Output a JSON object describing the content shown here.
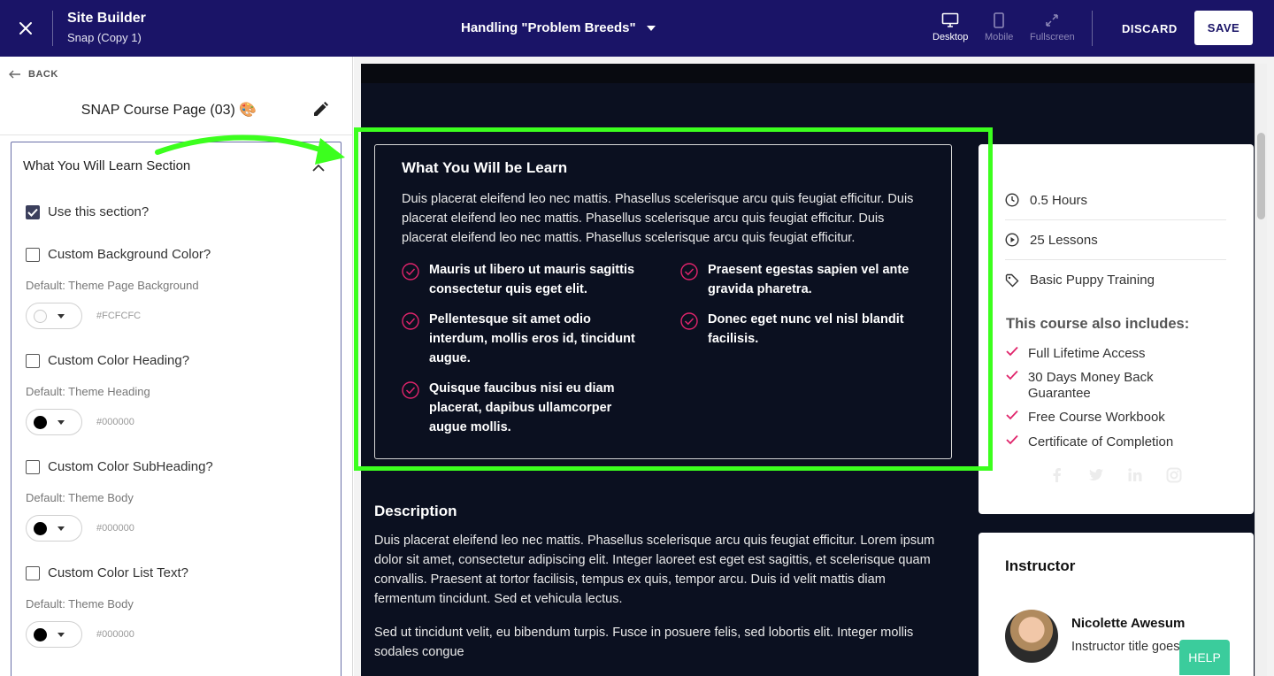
{
  "topbar": {
    "app_title": "Site Builder",
    "app_subtitle": "Snap (Copy 1)",
    "page_select": "Handling \"Problem Breeds\"",
    "views": [
      {
        "label": "Desktop",
        "icon": "desktop-icon",
        "active": true
      },
      {
        "label": "Mobile",
        "icon": "mobile-icon",
        "active": false
      },
      {
        "label": "Fullscreen",
        "icon": "fullscreen-icon",
        "active": false
      }
    ],
    "discard": "DISCARD",
    "save": "SAVE"
  },
  "sidebar": {
    "back": "BACK",
    "panel_title": "SNAP Course Page (03) 🎨",
    "section_title": "What You Will Learn Section",
    "options": [
      {
        "label": "Use this section?",
        "checked": true
      },
      {
        "label": "Custom Background Color?",
        "checked": false,
        "default": "Default: Theme Page Background",
        "hex": "#FCFCFC",
        "color": "#fcfcfc"
      },
      {
        "label": "Custom Color Heading?",
        "checked": false,
        "default": "Default: Theme Heading",
        "hex": "#000000",
        "color": "#000000"
      },
      {
        "label": "Custom Color SubHeading?",
        "checked": false,
        "default": "Default: Theme Body",
        "hex": "#000000",
        "color": "#000000"
      },
      {
        "label": "Custom Color List Text?",
        "checked": false,
        "default": "Default: Theme Body",
        "hex": "#000000",
        "color": "#000000"
      }
    ]
  },
  "preview": {
    "learn": {
      "title": "What You Will be Learn",
      "body": "Duis placerat eleifend leo nec mattis. Phasellus scelerisque arcu quis feugiat efficitur. Duis placerat eleifend leo nec mattis. Phasellus scelerisque arcu quis feugiat efficitur. Duis placerat eleifend leo nec mattis. Phasellus scelerisque arcu quis feugiat efficitur.",
      "items": [
        "Mauris ut libero ut mauris sagittis consectetur quis eget elit.",
        "Praesent egestas sapien vel ante gravida pharetra.",
        "Pellentesque sit amet odio interdum, mollis eros id, tincidunt augue.",
        "Donec eget nunc vel nisl blandit facilisis.",
        "Quisque faucibus nisi eu diam placerat, dapibus ullamcorper augue mollis."
      ]
    },
    "description": {
      "title": "Description",
      "paragraphs": [
        "Duis placerat eleifend leo nec mattis. Phasellus scelerisque arcu quis feugiat efficitur. Lorem ipsum dolor sit amet, consectetur adipiscing elit. Integer laoreet est eget est sagittis, et scelerisque quam convallis. Praesent at tortor facilisis, tempus ex quis, tempor arcu. Duis id velit mattis diam fermentum tincidunt. Sed et vehicula lectus.",
        "Sed ut tincidunt velit, eu bibendum turpis. Fusce in posuere felis, sed lobortis elit. Integer mollis sodales congue"
      ]
    },
    "course_meta": {
      "hours": "0.5 Hours",
      "lessons": "25 Lessons",
      "category": "Basic Puppy Training",
      "includes_title": "This course also includes:",
      "includes": [
        "Full Lifetime Access",
        "30 Days Money Back Guarantee",
        "Free Course Workbook",
        "Certificate of Completion"
      ]
    },
    "instructor": {
      "label": "Instructor",
      "name": "Nicolette Awesum",
      "subtitle": "Instructor title goes here"
    }
  },
  "help": "HELP",
  "colors": {
    "topbar": "#1a1467",
    "preview_bg": "#0b1020",
    "accent_check": "#e0246b",
    "highlight": "#3cff1e",
    "help": "#3bcc9c"
  }
}
